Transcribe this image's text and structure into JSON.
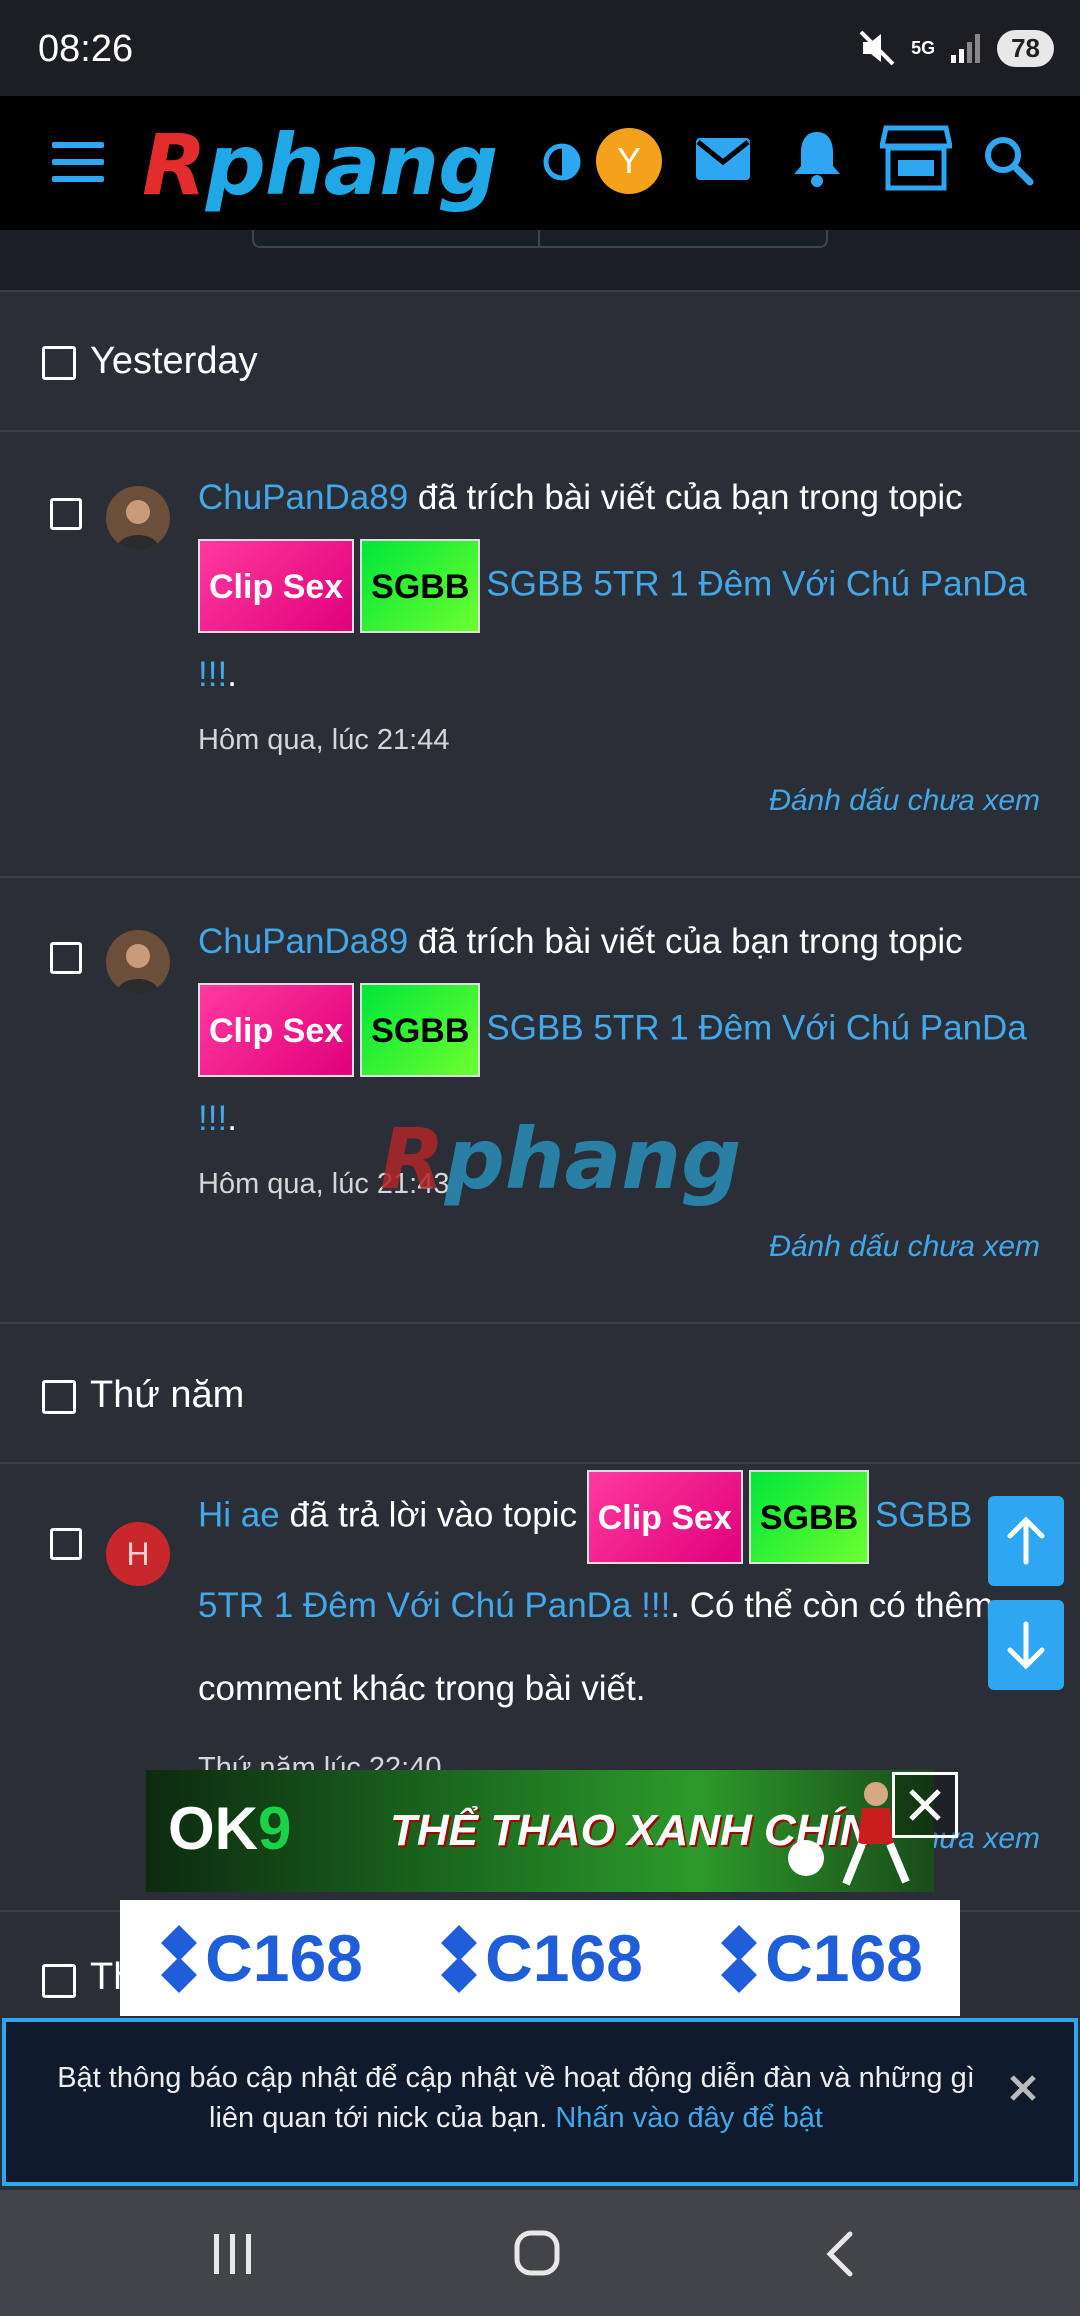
{
  "status_bar": {
    "time": "08:26",
    "battery": "78",
    "network": "5G"
  },
  "header": {
    "logo_first": "R",
    "logo_rest": "phang",
    "avatar_letter": "Y"
  },
  "groups": {
    "yesterday": "Yesterday",
    "thursday": "Thứ năm",
    "partial": "Th"
  },
  "alerts": [
    {
      "user": "ChuPanDa89",
      "action": " đã trích bài viết của bạn trong topic ",
      "prefix1": "Clip Sex",
      "prefix2": "SGBB",
      "topic": "SGBB 5TR 1 Đêm Với Chú PanDa !!!",
      "tail": ".",
      "date": "Hôm qua, lúc 21:44",
      "mark": "Đánh dấu chưa xem"
    },
    {
      "user": "ChuPanDa89",
      "action": " đã trích bài viết của bạn trong topic ",
      "prefix1": "Clip Sex",
      "prefix2": "SGBB",
      "topic": "SGBB 5TR 1 Đêm Với Chú PanDa !!!",
      "tail": ".",
      "date": "Hôm qua, lúc 21:43",
      "mark": "Đánh dấu chưa xem"
    },
    {
      "avatar_letter": "H",
      "user": "Hi ae",
      "action": " đã trả lời vào topic ",
      "prefix1": "Clip Sex",
      "prefix2": "SGBB",
      "topic": "SGBB 5TR 1 Đêm Với Chú PanDa !!!",
      "tail": ". Có thể còn có thêm comment khác trong bài viết.",
      "date": "Thứ năm lúc 22:40",
      "mark": "Đánh dấu chưa xem"
    }
  ],
  "watermark": {
    "first": "R",
    "rest": "phang"
  },
  "ads": {
    "banner1_brand_a": "OK",
    "banner1_brand_b": "9",
    "banner1_slogan": "THỂ THAO XANH CHÍN",
    "banner2_label": "C168"
  },
  "notice": {
    "text": "Bật thông báo cập nhật để cập nhật về hoạt động diễn đàn và những gì liên quan tới nick của bạn. ",
    "link": "Nhấn vào đây để bật"
  },
  "colors": {
    "accent": "#2ea6f2",
    "link": "#44a7e8",
    "background": "#2a2e37"
  }
}
